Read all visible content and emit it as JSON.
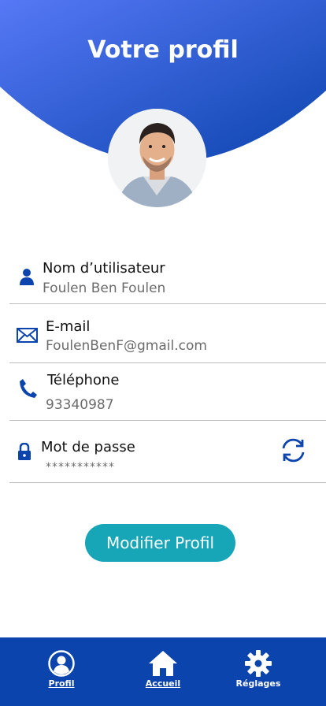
{
  "header": {
    "title": "Votre profil"
  },
  "profile": {
    "username_label": "Nom d’utilisateur",
    "username_value": "Foulen Ben Foulen",
    "email_label": "E-mail",
    "email_value": "FoulenBenF@gmail.com",
    "phone_label": "Téléphone",
    "phone_value": "93340987",
    "password_label": "Mot de passe",
    "password_value": "***********"
  },
  "actions": {
    "edit_label": "Modifier Profil"
  },
  "nav": {
    "profil": "Profil",
    "accueil": "Accueil",
    "reglages": "Réglages"
  },
  "colors": {
    "brand_blue": "#0b44ad",
    "gradient_start": "#4f76f5",
    "button_teal": "#16a6b7"
  },
  "icons": [
    "user-icon",
    "mail-icon",
    "phone-icon",
    "lock-icon",
    "refresh-icon",
    "profile-circle-icon",
    "home-icon",
    "gear-icon"
  ]
}
